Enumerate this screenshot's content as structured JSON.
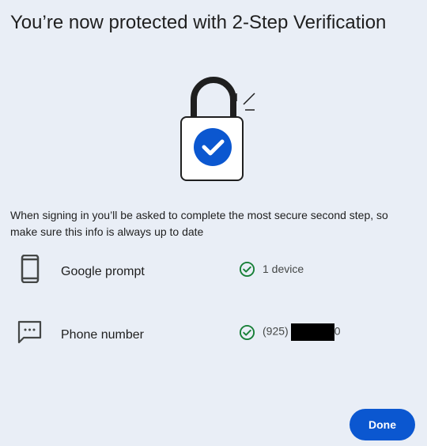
{
  "dialog": {
    "title": "You’re now protected with 2-Step Verification",
    "description": "When signing in you’ll be asked to complete the most secure second step, so make sure this info is always up to date"
  },
  "methods": [
    {
      "label": "Google prompt",
      "icon": "phone-icon",
      "status": "1 device",
      "status_icon": "check-circle-icon"
    },
    {
      "label": "Phone number",
      "icon": "sms-icon",
      "status_prefix": "(925)",
      "status_suffix": "0",
      "status_icon": "check-circle-icon"
    }
  ],
  "actions": {
    "done_label": "Done"
  },
  "colors": {
    "background": "#e9eef6",
    "primary": "#0b57d0",
    "success": "#188038",
    "text": "#1f1f1f"
  }
}
